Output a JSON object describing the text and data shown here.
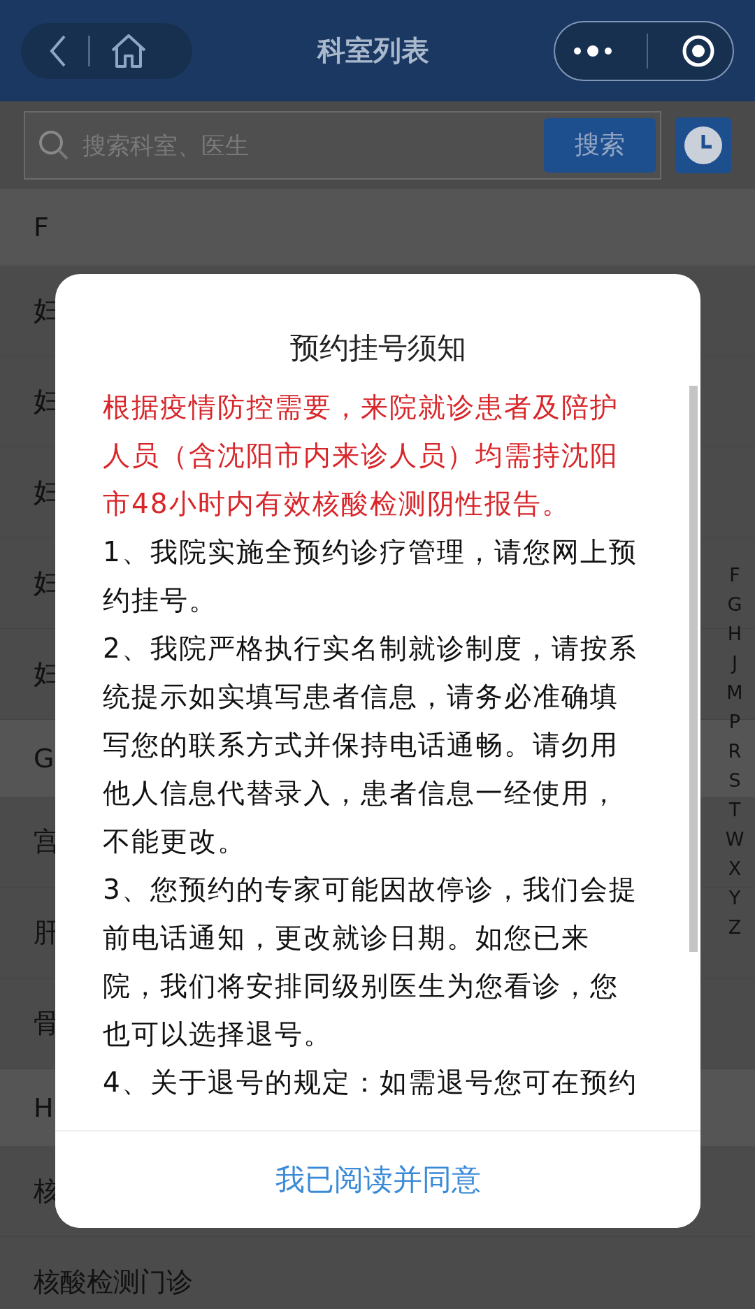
{
  "header": {
    "title": "科室列表"
  },
  "search": {
    "placeholder": "搜索科室、医生",
    "button": "搜索"
  },
  "sections": [
    {
      "letter": "F",
      "items": [
        "妇",
        "妇",
        "妇",
        "妇",
        "妇"
      ]
    },
    {
      "letter": "G",
      "items": [
        "宫",
        "肝",
        "骨"
      ]
    },
    {
      "letter": "H",
      "items": [
        "核",
        "核酸检测门诊"
      ]
    }
  ],
  "index_letters": [
    "F",
    "G",
    "H",
    "J",
    "M",
    "P",
    "R",
    "S",
    "T",
    "W",
    "X",
    "Y",
    "Z"
  ],
  "dialog": {
    "title": "预约挂号须知",
    "paragraphs": [
      {
        "kind": "warning",
        "text": "根据疫情防控需要，来院就诊患者及陪护人员（含沈阳市内来诊人员）均需持沈阳市48小时内有效核酸检测阴性报告。"
      },
      {
        "kind": "normal",
        "text": "1、我院实施全预约诊疗管理，请您网上预约挂号。"
      },
      {
        "kind": "normal",
        "text": "2、我院严格执行实名制就诊制度，请按系统提示如实填写患者信息，请务必准确填写您的联系方式并保持电话通畅。请勿用他人信息代替录入，患者信息一经使用，不能更改。"
      },
      {
        "kind": "normal",
        "text": "3、您预约的专家可能因故停诊，我们会提前电话通知，更改就诊日期。如您已来院，我们将安排同级别医生为您看诊，您也可以选择退号。"
      },
      {
        "kind": "normal",
        "text": "4、关于退号的规定：如需退号您可在预约"
      }
    ],
    "confirm": "我已阅读并同意"
  }
}
